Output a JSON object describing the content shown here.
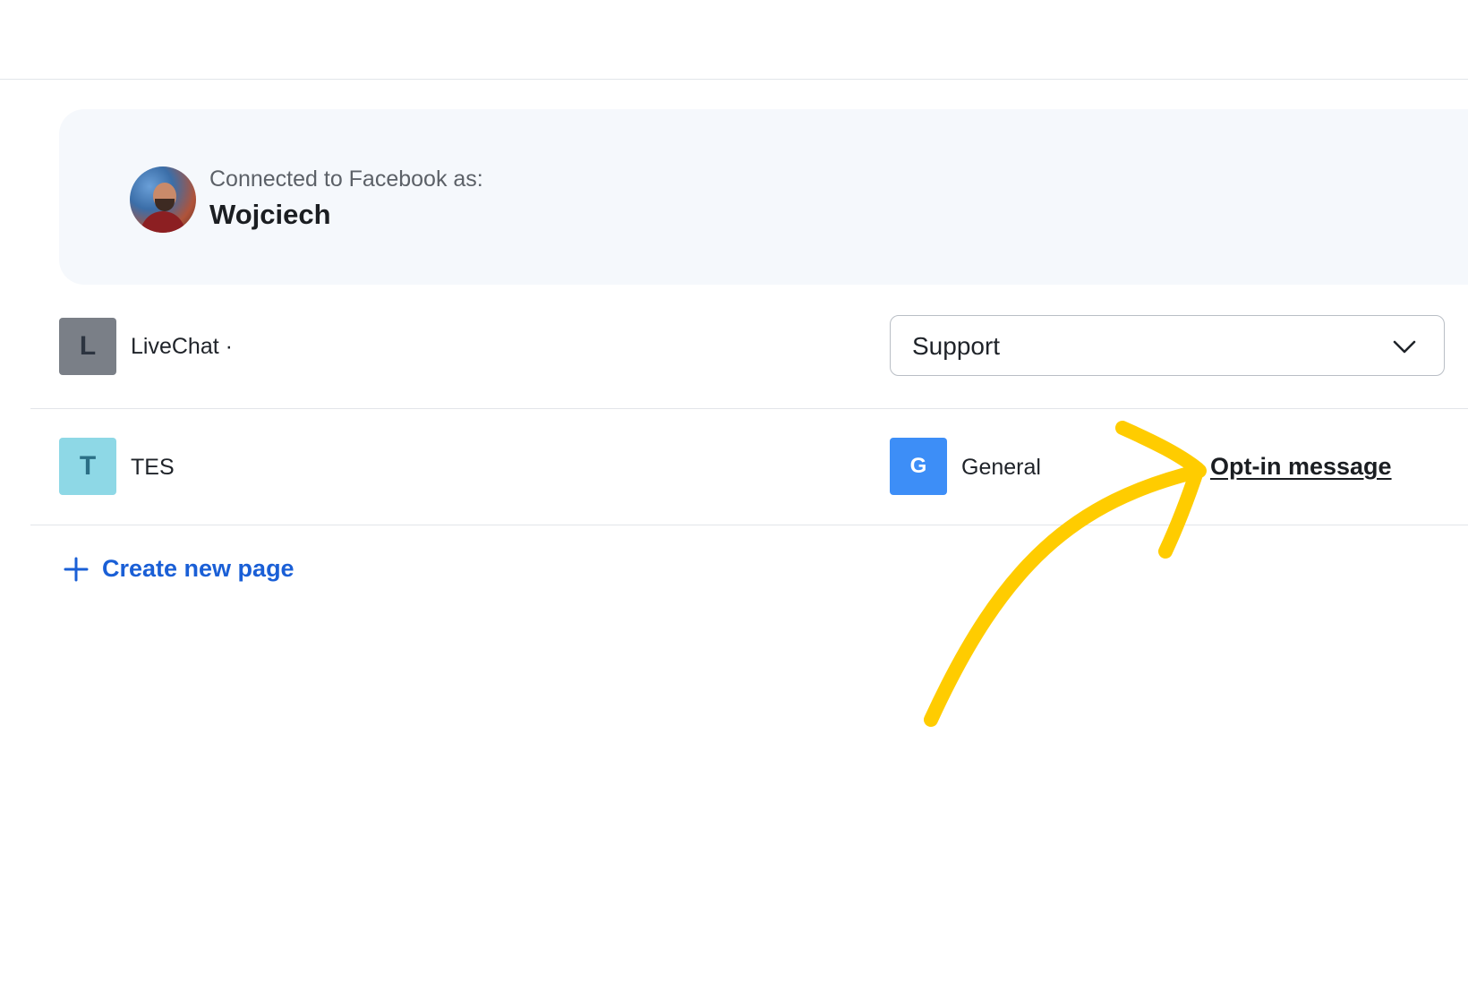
{
  "account": {
    "connected_label": "Connected to Facebook as:",
    "user_name": "Wojciech"
  },
  "pages": [
    {
      "initial": "L",
      "name": "LiveChat ·",
      "tile_color": "#7a7f87",
      "group_select": {
        "selected": "Support"
      }
    },
    {
      "initial": "T",
      "name": "TES",
      "tile_color": "#8ed8e6",
      "group": {
        "initial": "G",
        "name": "General",
        "tile_color": "#3d8ef7"
      },
      "optin_link": "Opt-in message"
    }
  ],
  "create_page": {
    "label": "Create new page",
    "icon": "plus-icon"
  },
  "colors": {
    "link_blue": "#1a5fd6",
    "card_bg": "#f5f8fc",
    "annotation_arrow": "#ffcc00"
  }
}
